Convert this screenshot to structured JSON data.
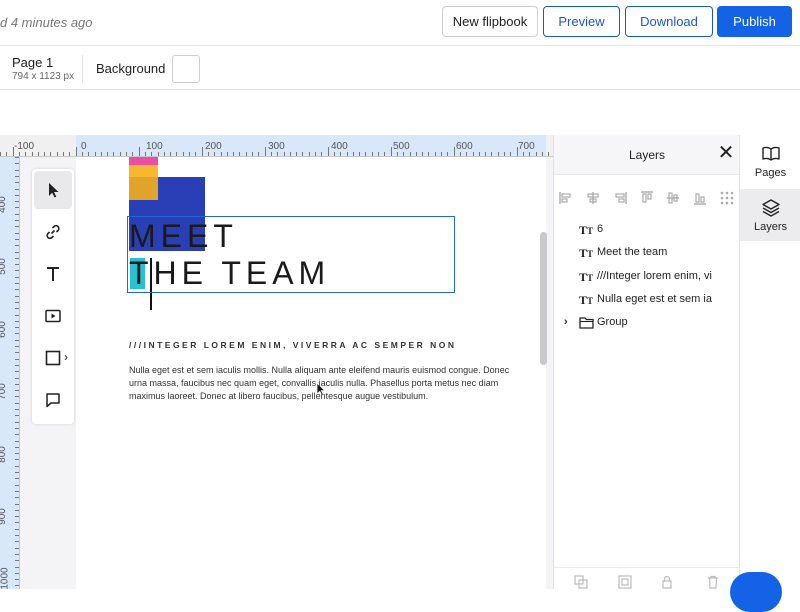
{
  "header": {
    "saved_text": "d 4 minutes ago",
    "new_flipbook": "New flipbook",
    "preview": "Preview",
    "download": "Download",
    "publish": "Publish"
  },
  "properties": {
    "page_name": "Page 1",
    "page_size": "794 x 1123 px",
    "background_label": "Background",
    "background_color": "#ffffff"
  },
  "ruler": {
    "top_labels": [
      "-100",
      "0",
      "100",
      "200",
      "300",
      "400",
      "500",
      "600",
      "700"
    ],
    "left_labels": [
      "400",
      "500",
      "600",
      "700",
      "800",
      "900",
      "1000"
    ]
  },
  "toolbar": {
    "tools": [
      "pointer-icon",
      "link-icon",
      "text-icon",
      "video-icon",
      "square-icon",
      "comment-icon"
    ]
  },
  "canvas": {
    "heading_line1": "MEET",
    "heading_line2": "THE TEAM",
    "subheading": "///INTEGER LOREM ENIM, VIVERRA AC SEMPER NON",
    "body": "Nulla eget est et sem iaculis mollis. Nulla aliquam ante eleifend mauris euismod congue. Donec urna massa, faucibus nec quam eget, convallis iaculis nulla. Phasellus porta metus nec diam maximus laoreet. Donec at libero faucibus, pellentesque augue vestibulum.",
    "colors": {
      "pink": "#e94fa5",
      "yellow": "#f5b82e",
      "mustard": "#e1a32a",
      "blue": "#2a3fb5",
      "cyan": "#29c0d3",
      "selection": "#2563d6"
    }
  },
  "layers_panel": {
    "title": "Layers",
    "items": [
      {
        "label": "6"
      },
      {
        "label": "Meet the team"
      },
      {
        "label": "///Integer lorem enim, vi"
      },
      {
        "label": "Nulla eget est et sem iac"
      }
    ],
    "group_label": "Group"
  },
  "side_rail": {
    "pages": "Pages",
    "layers": "Layers"
  }
}
